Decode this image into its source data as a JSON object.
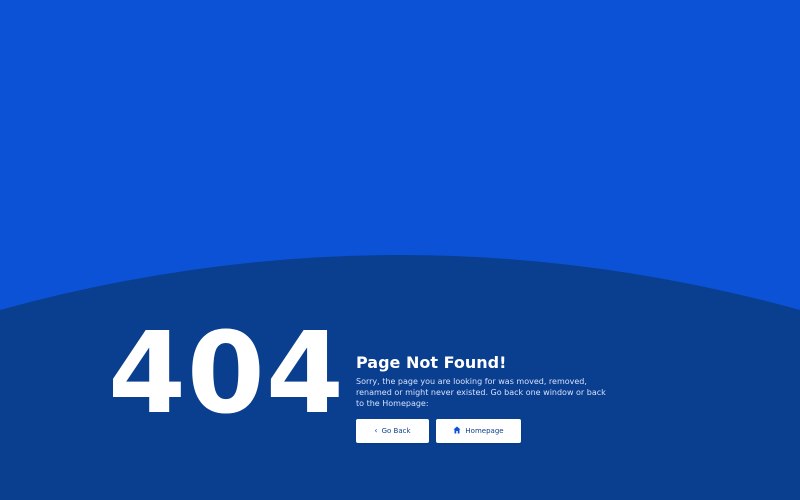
{
  "colors": {
    "upper_background": "#0c52d6",
    "lower_background": "#0a3e8f",
    "text": "#ffffff",
    "button_background": "#ffffff",
    "button_text": "#0e3f8d"
  },
  "error": {
    "code": "404",
    "title": "Page Not Found!",
    "description": "Sorry, the page you are looking for was moved, removed, renamed or might never existed. Go back one window or back to the Homepage:"
  },
  "actions": {
    "back": {
      "label": "Go Back",
      "icon": "chevron-left-icon"
    },
    "home": {
      "label": "Homepage",
      "icon": "home-icon"
    }
  }
}
